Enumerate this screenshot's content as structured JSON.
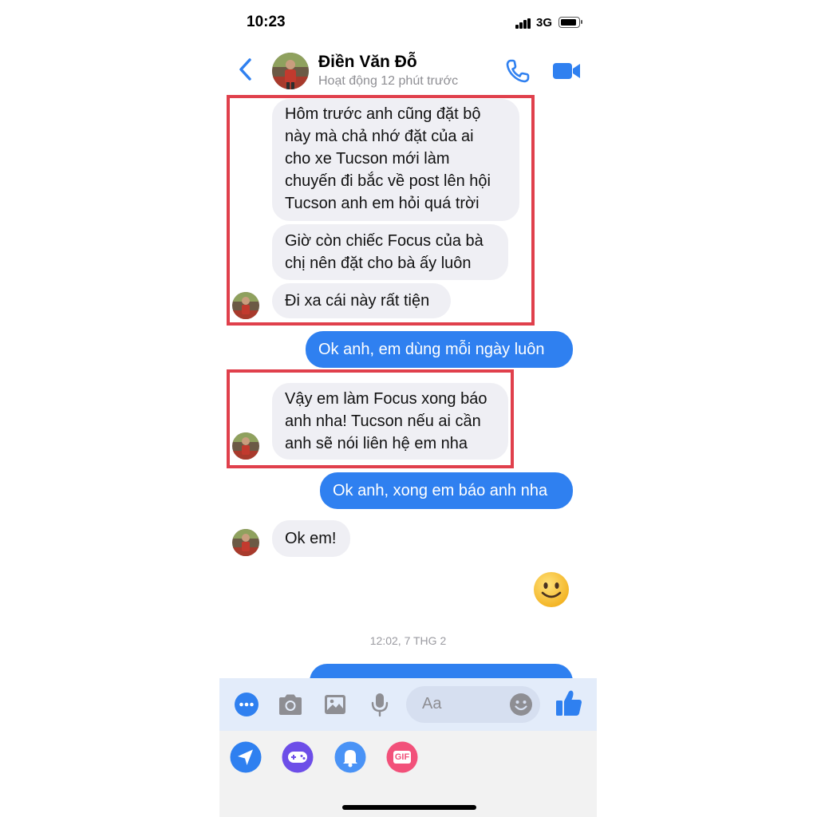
{
  "status_bar": {
    "time": "10:23",
    "network": "3G"
  },
  "header": {
    "contact_name": "Điền Văn Đỗ",
    "activity_status": "Hoạt động 12 phút trước"
  },
  "messages": [
    {
      "lines": [
        "Hôm trước anh cũng đặt bộ",
        "này mà chả nhớ đặt của ai",
        "cho xe Tucson mới làm",
        "chuyến đi bắc về post lên hội",
        "Tucson anh em hỏi quá trời"
      ]
    },
    {
      "lines": [
        "Giờ còn chiếc Focus của bà",
        "chị nên đặt cho bà ấy luôn"
      ]
    },
    {
      "lines": [
        "Đi xa cái này rất tiện"
      ]
    },
    {
      "lines": [
        "Ok anh, em dùng mỗi ngày luôn"
      ]
    },
    {
      "lines": [
        "Vậy em làm Focus xong báo",
        "anh nha! Tucson nếu ai cần",
        "anh sẽ nói liên hệ em nha"
      ]
    },
    {
      "lines": [
        "Ok anh, xong em báo anh nha"
      ]
    },
    {
      "lines": [
        "Ok em!"
      ]
    }
  ],
  "timestamp": "12:02, 7 THG 2",
  "composer": {
    "placeholder": "Aa"
  },
  "tray": {
    "gif_label": "GIF"
  },
  "colors": {
    "accent": "#2f80f0",
    "incoming_bubble": "#efeff4",
    "highlight_border": "#e0404c"
  }
}
